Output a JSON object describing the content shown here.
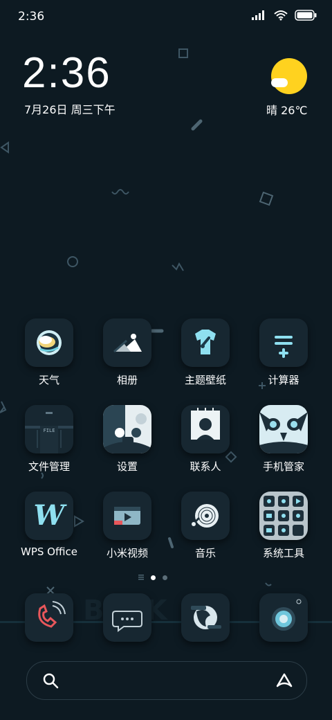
{
  "status_bar": {
    "time": "2:36"
  },
  "clock_widget": {
    "time": "2:36",
    "date": "7月26日 周三下午"
  },
  "weather_widget": {
    "text": "晴 26℃",
    "sun_color": "#ffd21f"
  },
  "apps": {
    "weather": "天气",
    "gallery": "相册",
    "themes": "主题壁纸",
    "calculator": "计算器",
    "file_manager": "文件管理",
    "settings": "设置",
    "contacts": "联系人",
    "security": "手机管家",
    "wps": "WPS Office",
    "mi_video": "小米视频",
    "music": "音乐",
    "system_tools": "系统工具"
  },
  "file_manager_icon_text": "FILE",
  "wps_icon_letter": "W",
  "page_indicator": {
    "pages": 2,
    "active": 1
  },
  "dock": {
    "apps": [
      "phone",
      "messages",
      "browser",
      "camera"
    ]
  },
  "search": {
    "icon": "search-icon",
    "assistant_icon": "assistant-icon"
  }
}
